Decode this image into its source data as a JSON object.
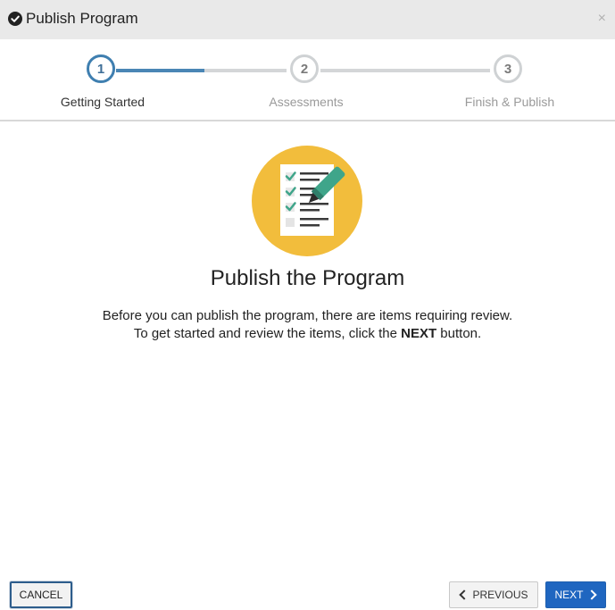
{
  "window": {
    "title": "Publish Program",
    "close_label": "×"
  },
  "stepper": {
    "steps": [
      {
        "number": "1",
        "label": "Getting Started",
        "active": true
      },
      {
        "number": "2",
        "label": "Assessments",
        "active": false
      },
      {
        "number": "3",
        "label": "Finish & Publish",
        "active": false
      }
    ]
  },
  "content": {
    "heading": "Publish the Program",
    "line1": "Before you can publish the program, there are items requiring review.",
    "line2_prefix": "To get started and review the items, click the ",
    "line2_bold": "NEXT",
    "line2_suffix": " button."
  },
  "buttons": {
    "cancel": "CANCEL",
    "previous": "PREVIOUS",
    "next": "NEXT"
  },
  "colors": {
    "accent": "#1f66c0",
    "step_active": "#3f7fb0",
    "illustration_bg": "#f2bd3c",
    "check": "#3fa58a"
  }
}
